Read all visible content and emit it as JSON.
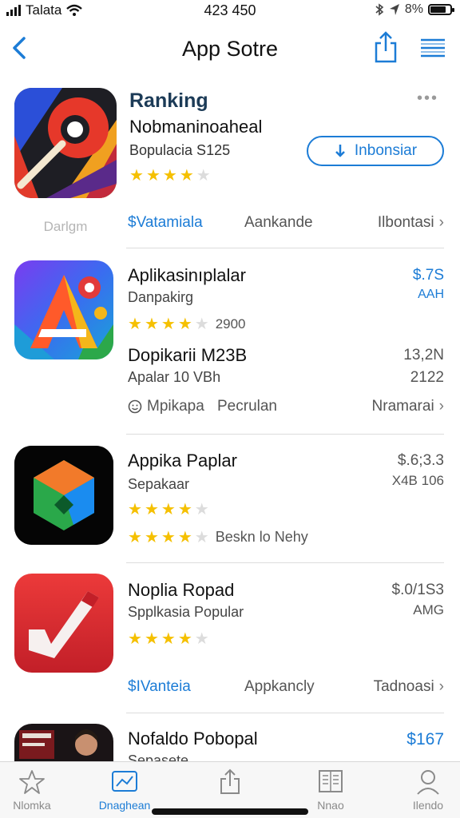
{
  "status": {
    "carrier": "Talata",
    "time": "423 450",
    "battery": "8%",
    "battery_level": 0.8
  },
  "nav": {
    "title": "App Sotre"
  },
  "featured": {
    "section": "Ranking",
    "name": "Nobmaninoaheal",
    "subtitle": "Bopulacia S125",
    "rating": 4,
    "install_label": "Inbonsiar",
    "icon_label": "Darlgm",
    "links": {
      "left": "$Vatamiala",
      "middle": "Aankande",
      "right": "Ilbontasi"
    }
  },
  "apps": [
    {
      "title": "Aplikasinıplalar",
      "subtitle": "Danpakirg",
      "rating": 4,
      "rating_count": "2900",
      "price": "$.7S",
      "price_sub": "AAH",
      "title2": "Dopikarii M23B",
      "subtitle2": "Apalar 10 VBh",
      "price2": "13,2N",
      "price2_sub": "2122",
      "link_left": "Mpikapa",
      "link_mid": "Pecrulan",
      "link_right": "Nramarai"
    },
    {
      "title": "Appika Paplar",
      "subtitle": "Sepakaar",
      "rating": 4,
      "price": "$.6;3.3",
      "price_sub": "X4B 106",
      "rating2": 4,
      "rating2_text": "Beskn lo Nehy"
    },
    {
      "title": "Noplia Ropad",
      "subtitle": "Spplkasia Popular",
      "rating": 4,
      "price": "$.0/1S3",
      "price_sub": "AMG",
      "link_left": "$IVanteia",
      "link_mid": "Appkancly",
      "link_right": "Tadnoasi"
    },
    {
      "title": "Nofaldo Pobopal",
      "subtitle": "Sepasete",
      "price": "$167"
    }
  ],
  "tabs": [
    {
      "label": "Nlomka",
      "icon": "star-icon"
    },
    {
      "label": "Dnaghean",
      "icon": "chart-icon",
      "active": true
    },
    {
      "label": "",
      "icon": "share-icon"
    },
    {
      "label": "Nnao",
      "icon": "book-icon"
    },
    {
      "label": "Ilendo",
      "icon": "person-icon"
    }
  ],
  "colors": {
    "accent": "#1c7cd6",
    "star": "#f5c000"
  }
}
